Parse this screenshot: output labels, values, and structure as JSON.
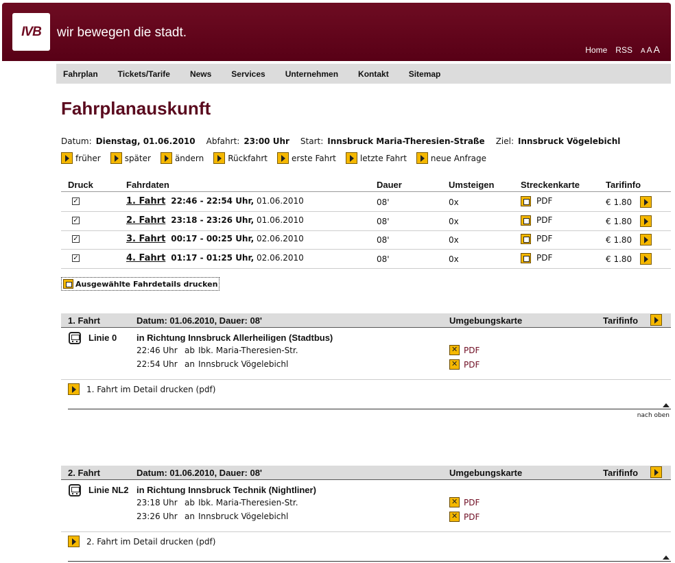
{
  "header": {
    "logo": "IVB",
    "slogan": "wir bewegen die stadt.",
    "links": [
      "Home",
      "RSS"
    ],
    "font_size_labels": [
      "A",
      "A",
      "A"
    ]
  },
  "nav": [
    "Fahrplan",
    "Tickets/Tarife",
    "News",
    "Services",
    "Unternehmen",
    "Kontakt",
    "Sitemap"
  ],
  "page_title": "Fahrplanauskunft",
  "query": {
    "datum_label": "Datum:",
    "datum": "Dienstag, 01.06.2010",
    "abfahrt_label": "Abfahrt:",
    "abfahrt": "23:00 Uhr",
    "start_label": "Start:",
    "start": "Innsbruck Maria-Theresien-Straße",
    "ziel_label": "Ziel:",
    "ziel": "Innsbruck Vögelebichl"
  },
  "actions": [
    "früher",
    "später",
    "ändern",
    "Rückfahrt",
    "erste Fahrt",
    "letzte Fahrt",
    "neue Anfrage"
  ],
  "table": {
    "headers": [
      "Druck",
      "Fahrdaten",
      "Dauer",
      "Umsteigen",
      "Streckenkarte",
      "Tarifinfo"
    ],
    "rows": [
      {
        "check": "✓",
        "fahrt": "1. Fahrt",
        "time": "22:46 - 22:54 Uhr,",
        "date": "01.06.2010",
        "dauer": "08'",
        "umsteigen": "0x",
        "karte": "PDF",
        "tarif": "€ 1.80"
      },
      {
        "check": "✓",
        "fahrt": "2. Fahrt",
        "time": "23:18 - 23:26 Uhr,",
        "date": "01.06.2010",
        "dauer": "08'",
        "umsteigen": "0x",
        "karte": "PDF",
        "tarif": "€ 1.80"
      },
      {
        "check": "✓",
        "fahrt": "3. Fahrt",
        "time": "00:17 - 00:25 Uhr,",
        "date": "02.06.2010",
        "dauer": "08'",
        "umsteigen": "0x",
        "karte": "PDF",
        "tarif": "€ 1.80"
      },
      {
        "check": "✓",
        "fahrt": "4. Fahrt",
        "time": "01:17 - 01:25 Uhr,",
        "date": "02.06.2010",
        "dauer": "08'",
        "umsteigen": "0x",
        "karte": "PDF",
        "tarif": "€ 1.80"
      }
    ]
  },
  "print_selected": "Ausgewählte Fahrdetails drucken",
  "sections": [
    {
      "title": "1. Fahrt",
      "datum": "Datum: 01.06.2010, Dauer: 08'",
      "umgebung": "Umgebungskarte",
      "tarif": "Tarifinfo",
      "linie": "Linie 0",
      "richtung": "in Richtung Innsbruck Allerheiligen (Stadtbus)",
      "stops": [
        {
          "time": "22:46 Uhr",
          "type": "ab",
          "name": "Ibk. Maria-Theresien-Str.",
          "pdf": "PDF"
        },
        {
          "time": "22:54 Uhr",
          "type": "an",
          "name": "Innsbruck Vögelebichl",
          "pdf": "PDF"
        }
      ],
      "detail_print": "1. Fahrt im Detail drucken (pdf)",
      "nach_oben": "nach oben"
    },
    {
      "title": "2. Fahrt",
      "datum": "Datum: 01.06.2010, Dauer: 08'",
      "umgebung": "Umgebungskarte",
      "tarif": "Tarifinfo",
      "linie": "Linie NL2",
      "richtung": "in Richtung Innsbruck Technik (Nightliner)",
      "stops": [
        {
          "time": "23:18 Uhr",
          "type": "ab",
          "name": "Ibk. Maria-Theresien-Str.",
          "pdf": "PDF"
        },
        {
          "time": "23:26 Uhr",
          "type": "an",
          "name": "Innsbruck Vögelebichl",
          "pdf": "PDF"
        }
      ],
      "detail_print": "2. Fahrt im Detail drucken (pdf)"
    }
  ]
}
